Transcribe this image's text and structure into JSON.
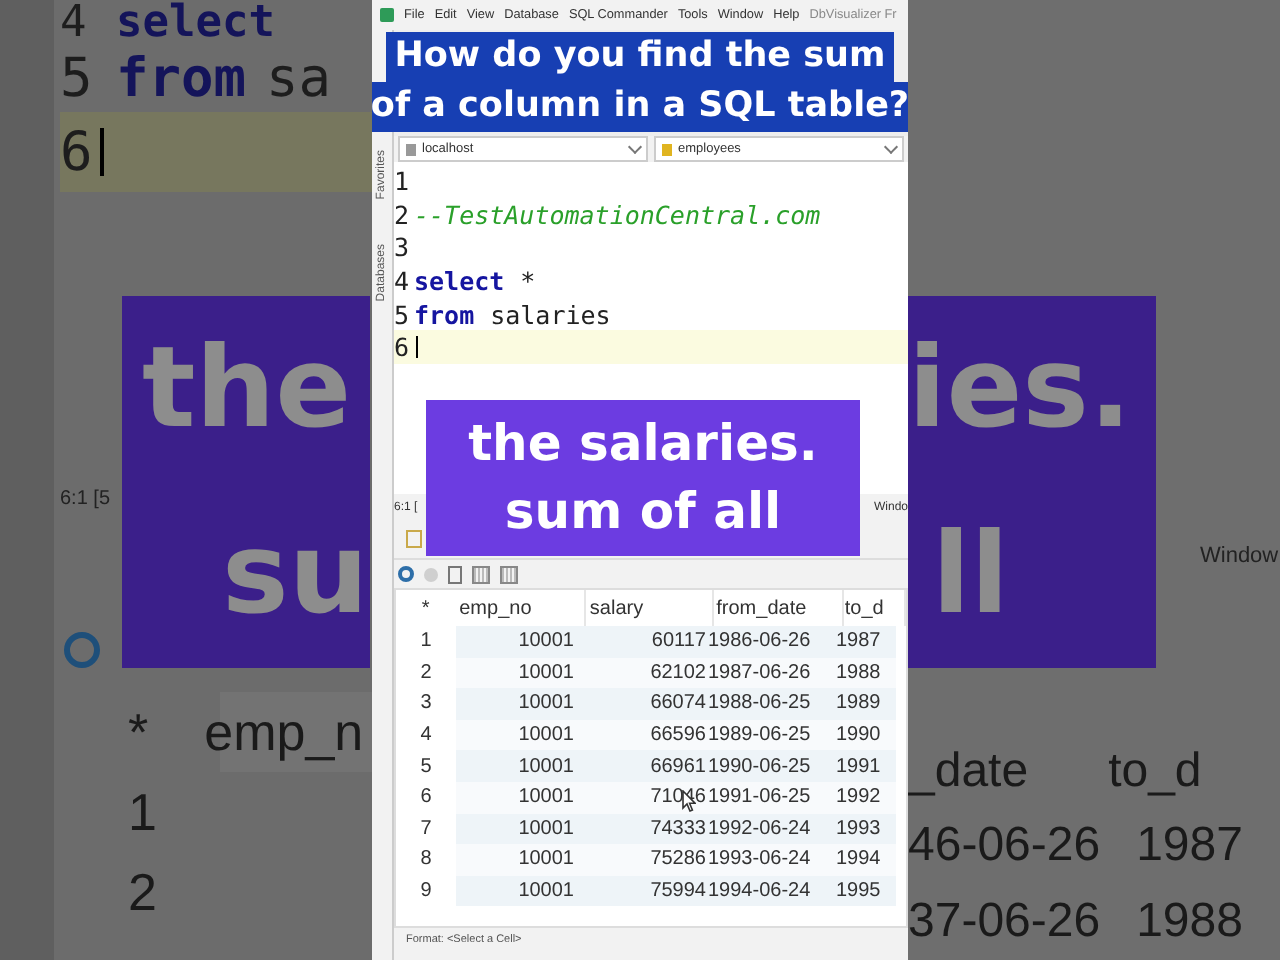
{
  "backdrop_left": {
    "code_lines": [
      {
        "number": "4",
        "keyword": "select",
        "current": false
      },
      {
        "number": "5",
        "keyword": "from",
        "rest": "sa",
        "current": false
      },
      {
        "number": "6",
        "current": true
      }
    ],
    "status": "6:1 [5",
    "header": [
      "*",
      "emp_n"
    ],
    "rows": [
      [
        "1"
      ],
      [
        "2"
      ]
    ],
    "caption": [
      "the",
      "su"
    ]
  },
  "app": {
    "menu": [
      "File",
      "Edit",
      "View",
      "Database",
      "SQL Commander",
      "Tools",
      "Window",
      "Help"
    ],
    "app_title": "DbVisualizer Fr",
    "side_tabs": [
      "Favorites",
      "Databases"
    ],
    "connection": {
      "server": "localhost",
      "database": "employees"
    },
    "editor": {
      "lines": [
        {
          "number": "1",
          "current": false
        },
        {
          "number": "2",
          "comment": "--TestAutomationCentral.com",
          "current": false
        },
        {
          "number": "3",
          "current": false
        },
        {
          "number": "4",
          "keyword": "select",
          "rest": "*",
          "current": false
        },
        {
          "number": "5",
          "keyword": "from",
          "rest": "salaries",
          "current": false
        },
        {
          "number": "6",
          "current": true
        }
      ]
    },
    "status": {
      "position": "6:1 [",
      "window": "Windo"
    },
    "grid": {
      "columns": [
        "*",
        "emp_no",
        "salary",
        "from_date",
        "to_d"
      ],
      "rows": [
        [
          "1",
          "10001",
          "60117",
          "1986-06-26",
          "1987"
        ],
        [
          "2",
          "10001",
          "62102",
          "1987-06-26",
          "1988"
        ],
        [
          "3",
          "10001",
          "66074",
          "1988-06-25",
          "1989"
        ],
        [
          "4",
          "10001",
          "66596",
          "1989-06-25",
          "1990"
        ],
        [
          "5",
          "10001",
          "66961",
          "1990-06-25",
          "1991"
        ],
        [
          "6",
          "10001",
          "71046",
          "1991-06-25",
          "1992"
        ],
        [
          "7",
          "10001",
          "74333",
          "1992-06-24",
          "1993"
        ],
        [
          "8",
          "10001",
          "75286",
          "1993-06-24",
          "1994"
        ],
        [
          "9",
          "10001",
          "75994",
          "1994-06-24",
          "1995"
        ]
      ]
    },
    "format": "Format: <Select a Cell>"
  },
  "captions": [
    {
      "kind": "question",
      "lines": [
        "How do you find the sum",
        "of a column in a SQL table?"
      ]
    },
    {
      "kind": "subtitle",
      "lines": [
        "the salaries.",
        "sum of all"
      ]
    }
  ],
  "backdrop_right": {
    "status": "Window",
    "header": [
      "_date",
      "to_d"
    ],
    "rows": [
      [
        "46-06-26",
        "1987"
      ],
      [
        "37-06-26",
        "1988"
      ]
    ],
    "caption": [
      "ies.",
      "ll"
    ]
  }
}
